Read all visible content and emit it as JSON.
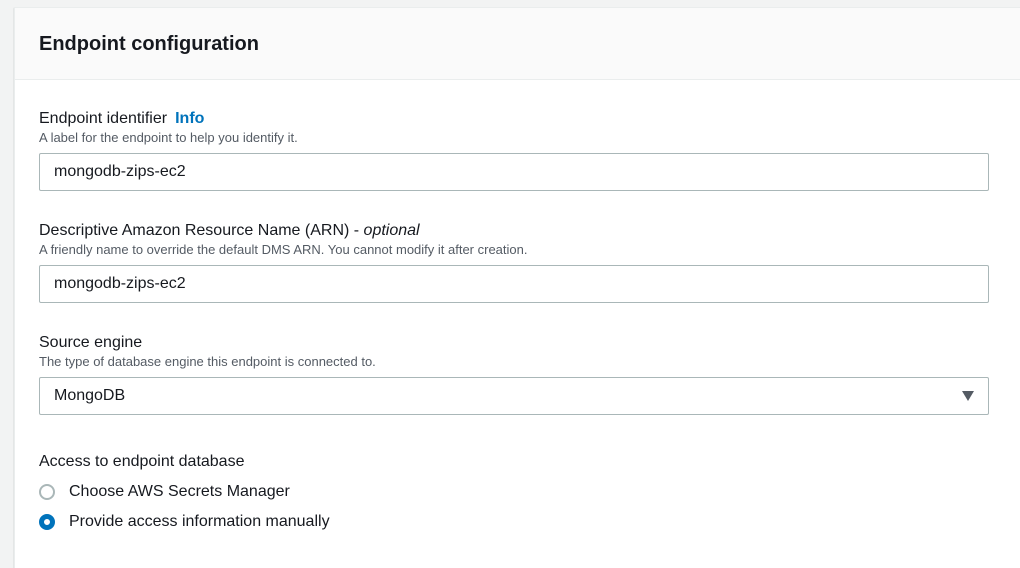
{
  "panel": {
    "title": "Endpoint configuration"
  },
  "endpoint_identifier": {
    "label": "Endpoint identifier",
    "info": "Info",
    "description": "A label for the endpoint to help you identify it.",
    "value": "mongodb-zips-ec2"
  },
  "arn": {
    "label": "Descriptive Amazon Resource Name (ARN) -",
    "optional": "optional",
    "description": "A friendly name to override the default DMS ARN. You cannot modify it after creation.",
    "value": "mongodb-zips-ec2"
  },
  "source_engine": {
    "label": "Source engine",
    "description": "The type of database engine this endpoint is connected to.",
    "selected": "MongoDB",
    "caret_icon": "caret-down-icon"
  },
  "access": {
    "label": "Access to endpoint database",
    "options": [
      {
        "label": "Choose AWS Secrets Manager",
        "checked": false
      },
      {
        "label": "Provide access information manually",
        "checked": true
      }
    ]
  },
  "colors": {
    "accent": "#0073bb",
    "text": "#16191f",
    "secondary_text": "#545b64",
    "border": "#aab7b8",
    "header_bg": "#fafafa",
    "page_bg": "#f2f3f3"
  }
}
